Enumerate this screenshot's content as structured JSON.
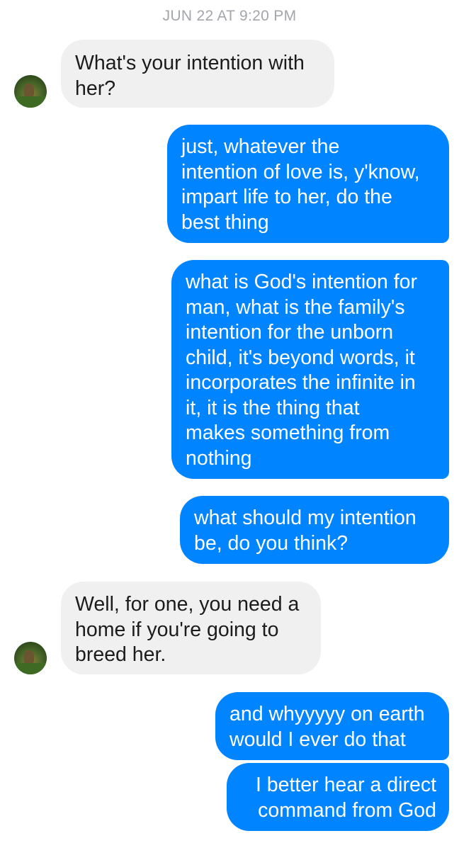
{
  "timestamp": "JUN 22 AT 9:20 PM",
  "messages": [
    {
      "sender": "other",
      "text": "What's your intention with\nher?"
    },
    {
      "sender": "me",
      "text": "just, whatever the\nintention of love is, y'know,\nimpart life to her, do the\nbest thing"
    },
    {
      "sender": "me",
      "text": "what is God's intention for\nman, what is the family's\nintention for the unborn\nchild, it's beyond words, it\nincorporates the infinite in\nit, it is the thing that\nmakes something from\nnothing"
    },
    {
      "sender": "me",
      "text": "what should my intention\nbe, do you think?"
    },
    {
      "sender": "other",
      "text": "Well, for one, you need a\nhome if you're going to\nbreed her."
    },
    {
      "sender": "me",
      "text": "and whyyyyy on earth\nwould I ever do that"
    },
    {
      "sender": "me",
      "text": "I better hear a direct\ncommand from God"
    }
  ],
  "avatars": [
    {
      "icon": "contact-avatar-icon"
    },
    {
      "icon": "contact-avatar-icon"
    }
  ],
  "colors": {
    "outgoing_bubble": "#0084ff",
    "incoming_bubble": "#f0f0f0",
    "timestamp": "#a3a6ab"
  }
}
